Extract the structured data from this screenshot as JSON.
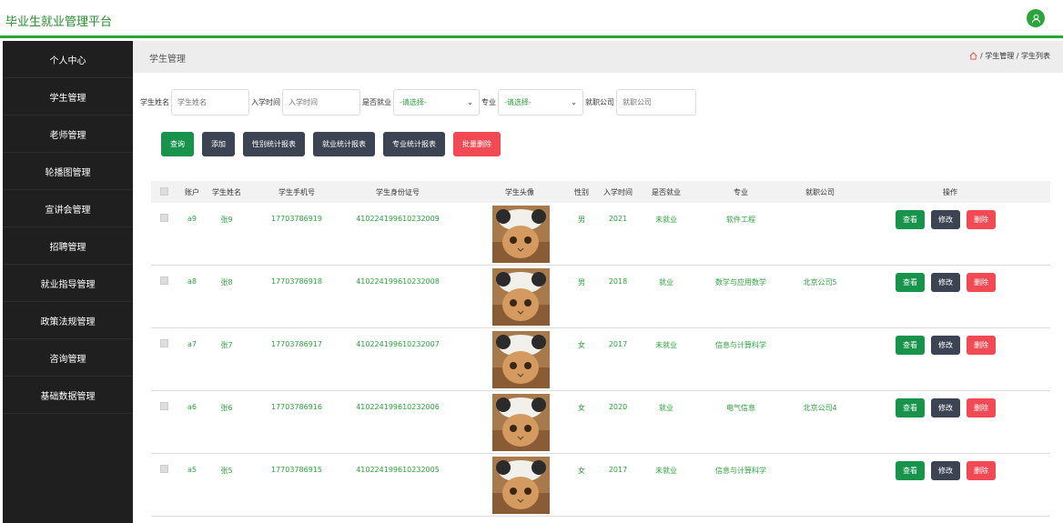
{
  "app": {
    "title": "毕业生就业管理平台"
  },
  "sidebar": {
    "items": [
      {
        "label": "个人中心"
      },
      {
        "label": "学生管理"
      },
      {
        "label": "老师管理"
      },
      {
        "label": "轮播图管理"
      },
      {
        "label": "宣讲会管理"
      },
      {
        "label": "招聘管理"
      },
      {
        "label": "就业指导管理"
      },
      {
        "label": "政策法规管理"
      },
      {
        "label": "咨询管理"
      },
      {
        "label": "基础数据管理"
      }
    ]
  },
  "crumb": {
    "title": "学生管理",
    "path": "/ 学生管理 / 学生列表"
  },
  "filters": {
    "name_label": "学生姓名",
    "name_placeholder": "学生姓名",
    "date_label": "入学时间",
    "date_placeholder": "入学时间",
    "employed_label": "是否就业",
    "employed_value": "-请选择-",
    "major_label": "专业",
    "major_value": "-请选择-",
    "company_label": "就职公司",
    "company_placeholder": "就职公司"
  },
  "actions": {
    "query": "查询",
    "add": "添加",
    "gender_report": "性别统计报表",
    "employ_report": "就业统计报表",
    "major_report": "专业统计报表",
    "batch_delete": "批量删除"
  },
  "table": {
    "headers": [
      "账户",
      "学生姓名",
      "学生手机号",
      "学生身份证号",
      "学生头像",
      "性别",
      "入学时间",
      "是否就业",
      "专业",
      "就职公司",
      "操作"
    ],
    "row_buttons": {
      "view": "查看",
      "edit": "修改",
      "delete": "删除"
    },
    "rows": [
      {
        "account": "a9",
        "name": "张9",
        "phone": "17703786919",
        "idcard": "410224199610232009",
        "gender": "男",
        "year": "2021",
        "employed": "未就业",
        "major": "软件工程",
        "company": ""
      },
      {
        "account": "a8",
        "name": "张8",
        "phone": "17703786918",
        "idcard": "410224199610232008",
        "gender": "男",
        "year": "2018",
        "employed": "就业",
        "major": "数学与应用数学",
        "company": "北京公司5"
      },
      {
        "account": "a7",
        "name": "张7",
        "phone": "17703786917",
        "idcard": "410224199610232007",
        "gender": "女",
        "year": "2017",
        "employed": "未就业",
        "major": "信息与计算科学",
        "company": ""
      },
      {
        "account": "a6",
        "name": "张6",
        "phone": "17703786916",
        "idcard": "410224199610232006",
        "gender": "女",
        "year": "2020",
        "employed": "就业",
        "major": "电气信息",
        "company": "北京公司4"
      },
      {
        "account": "a5",
        "name": "张5",
        "phone": "17703786915",
        "idcard": "410224199610232005",
        "gender": "女",
        "year": "2017",
        "employed": "未就业",
        "major": "信息与计算科学",
        "company": ""
      }
    ]
  }
}
